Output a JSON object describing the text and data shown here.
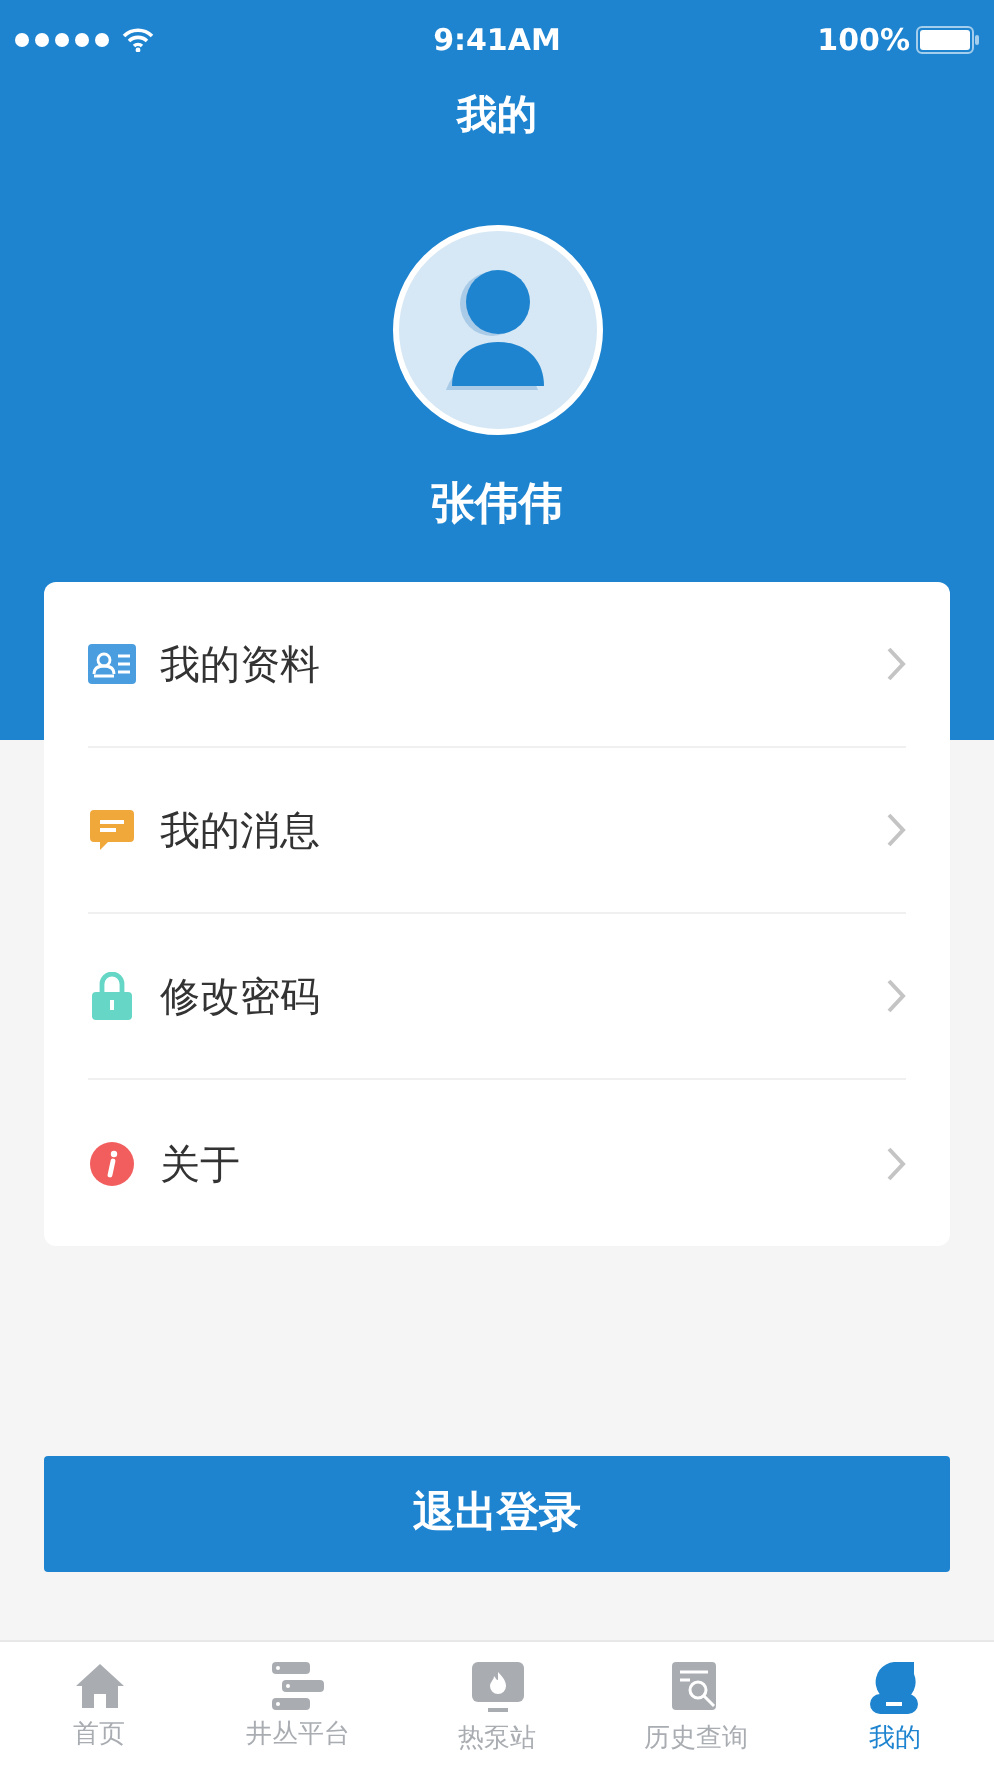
{
  "status_bar": {
    "time": "9:41AM",
    "battery": "100%"
  },
  "title": "我的",
  "profile": {
    "name": "张伟伟"
  },
  "menu": [
    {
      "kind": "profile",
      "label": "我的资料"
    },
    {
      "kind": "message",
      "label": "我的消息"
    },
    {
      "kind": "password",
      "label": "修改密码"
    },
    {
      "kind": "about",
      "label": "关于"
    }
  ],
  "logout_button": "退出登录",
  "tab_bar": [
    {
      "kind": "home",
      "label": "首页",
      "selected": false
    },
    {
      "kind": "platform",
      "label": "井丛平台",
      "selected": false
    },
    {
      "kind": "station",
      "label": "热泵站",
      "selected": false
    },
    {
      "kind": "history",
      "label": "历史查询",
      "selected": false
    },
    {
      "kind": "me",
      "label": "我的",
      "selected": true
    }
  ]
}
